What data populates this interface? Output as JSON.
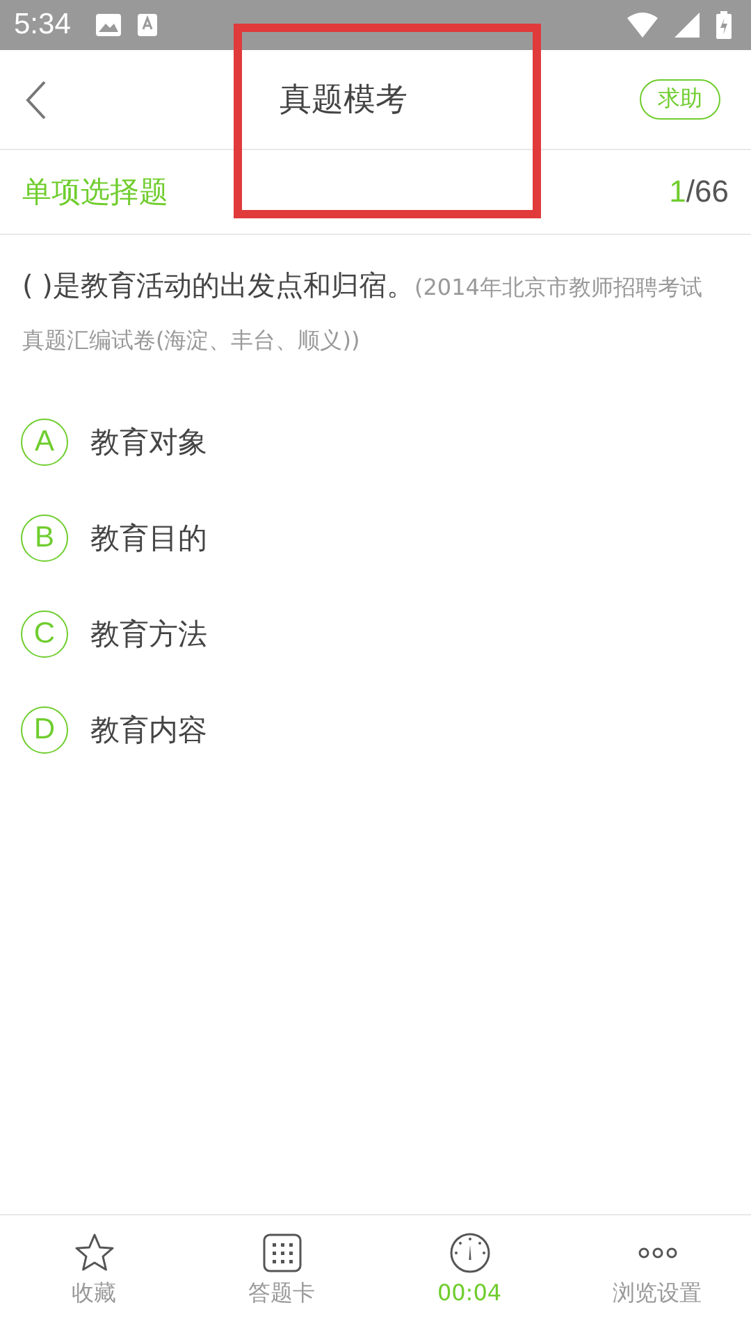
{
  "status_bar": {
    "time": "5:34"
  },
  "header": {
    "title": "真题模考",
    "help_button": "求助"
  },
  "section": {
    "title": "单项选择题",
    "current": "1",
    "total": "/66"
  },
  "question": {
    "text": "( )是教育活动的出发点和归宿。",
    "source": "(2014年北京市教师招聘考试真题汇编试卷(海淀、丰台、顺义))"
  },
  "options": [
    {
      "letter": "A",
      "text": "教育对象"
    },
    {
      "letter": "B",
      "text": "教育目的"
    },
    {
      "letter": "C",
      "text": "教育方法"
    },
    {
      "letter": "D",
      "text": "教育内容"
    }
  ],
  "bottom_nav": [
    {
      "kind": "favorite",
      "label": "收藏"
    },
    {
      "kind": "answer_card",
      "label": "答题卡"
    },
    {
      "kind": "timer",
      "label": "00:04"
    },
    {
      "kind": "settings",
      "label": "浏览设置"
    }
  ]
}
